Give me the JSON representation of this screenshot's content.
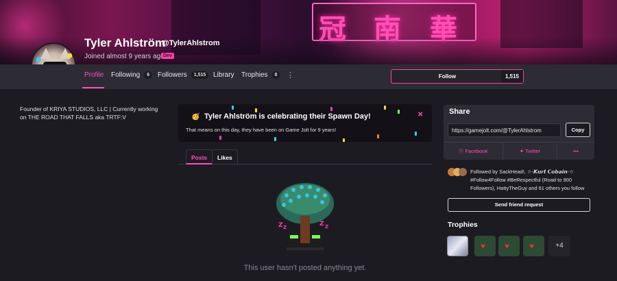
{
  "colors": {
    "accent": "#ff4fc0",
    "background": "#1d1b22",
    "panel": "#2d2b33"
  },
  "profile": {
    "name": "Tyler Ahlström",
    "handle": "@TylerAhlstrom",
    "joined": "Joined almost 9 years ago",
    "badge": "Dev"
  },
  "nav": {
    "tabs": [
      {
        "label": "Profile"
      },
      {
        "label": "Following",
        "count": "6"
      },
      {
        "label": "Followers",
        "count": "1,515"
      },
      {
        "label": "Library"
      },
      {
        "label": "Trophies",
        "count": "8"
      }
    ],
    "more_icon": "⋮"
  },
  "follow": {
    "label": "Follow",
    "count": "1,515"
  },
  "bio": "Founder of KRIYA STUDIOS, LLC | Currently working on THE ROAD THAT FALLS aka TRTF:V",
  "spawn": {
    "emoji": "🥳",
    "title": "Tyler Ahlström is celebrating their Spawn Day!",
    "text": "That means on this day, they have been on Game Jolt for 9 years!",
    "close": "✕"
  },
  "feed_tabs": {
    "posts": "Posts",
    "likes": "Likes"
  },
  "empty_text": "This user hasn't posted anything yet.",
  "sleep_marks": [
    "Z",
    "Z",
    "Z",
    "Z"
  ],
  "share": {
    "heading": "Share",
    "url": "https://gamejolt.com/@TylerAhlstrom",
    "copy": "Copy",
    "facebook": "Facebook",
    "twitter": "Twitter",
    "more": "•••"
  },
  "followed_by": "Followed by SackHead!, ☆-𝙆𝙪𝙧𝙩 𝘾𝙤𝙗𝙖𝙞𝙣-☆ #Follow4Follow #BeRespectful (Road to 900 Followers), HattyTheGuy and 61 others you follow",
  "friend_request": "Send friend request",
  "trophies": {
    "heading": "Trophies",
    "more": "+4"
  },
  "icons": {
    "facebook": "facebook-icon",
    "twitter": "twitter-icon",
    "heart": "heart-icon"
  }
}
